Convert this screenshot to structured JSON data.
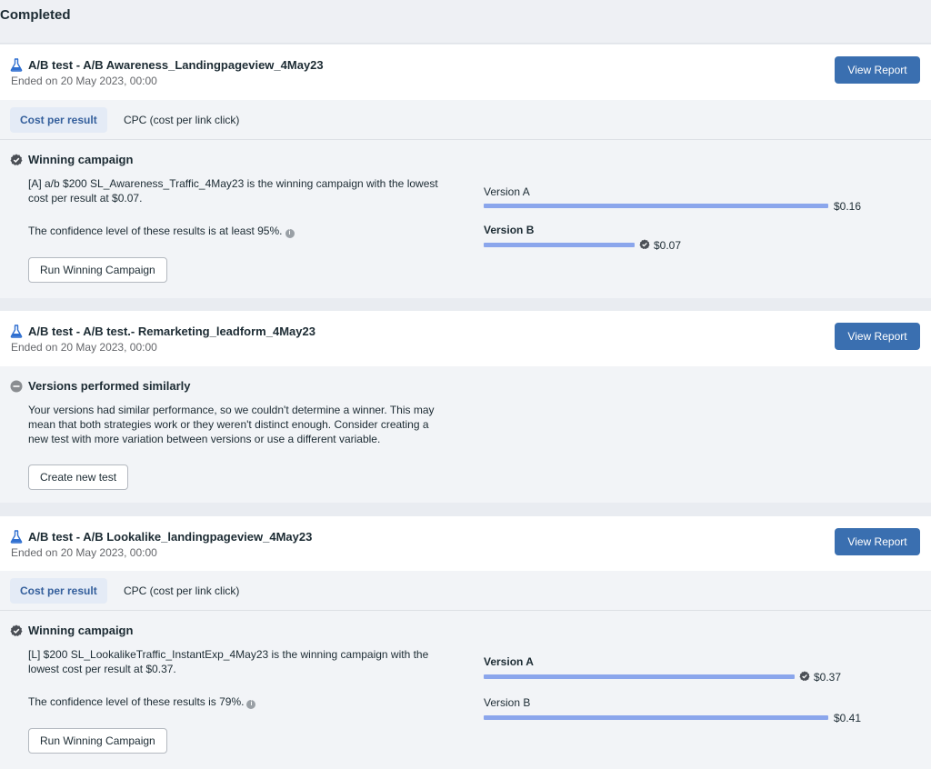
{
  "page": {
    "title": "Completed"
  },
  "tests": [
    {
      "title": "A/B test - A/B Awareness_Landingpageview_4May23",
      "ended": "Ended on 20 May 2023, 00:00",
      "view_report": "View Report",
      "tabs": {
        "active": "Cost per result",
        "other": "CPC (cost per link click)"
      },
      "result": {
        "heading": "Winning campaign",
        "description": "[A] a/b $200 SL_Awareness_Traffic_4May23 is the winning campaign with the lowest cost per result at $0.07.",
        "confidence": "The confidence level of these results is at least 95%.",
        "button": "Run Winning Campaign",
        "versions": [
          {
            "label": "Version A",
            "value": "$0.16",
            "amount": 0.16,
            "winner": false
          },
          {
            "label": "Version B",
            "value": "$0.07",
            "amount": 0.07,
            "winner": true
          }
        ]
      }
    },
    {
      "title": "A/B test - A/B test.- Remarketing_leadform_4May23",
      "ended": "Ended on 20 May 2023, 00:00",
      "view_report": "View Report",
      "result": {
        "heading": "Versions performed similarly",
        "description": "Your versions had similar performance, so we couldn't determine a winner. This may mean that both strategies work or they weren't distinct enough. Consider creating a new test with more variation between versions or use a different variable.",
        "button": "Create new test"
      }
    },
    {
      "title": "A/B test - A/B Lookalike_landingpageview_4May23",
      "ended": "Ended on 20 May 2023, 00:00",
      "view_report": "View Report",
      "tabs": {
        "active": "Cost per result",
        "other": "CPC (cost per link click)"
      },
      "result": {
        "heading": "Winning campaign",
        "description": "[L] $200 SL_LookalikeTraffic_InstantExp_4May23 is the winning campaign with the lowest cost per result at $0.37.",
        "confidence": "The confidence level of these results is 79%.",
        "button": "Run Winning Campaign",
        "versions": [
          {
            "label": "Version A",
            "value": "$0.37",
            "amount": 0.37,
            "winner": true
          },
          {
            "label": "Version B",
            "value": "$0.41",
            "amount": 0.41,
            "winner": false
          }
        ]
      }
    }
  ],
  "colors": {
    "primary_button": "#3a6fb0",
    "bar": "#8ba6ec",
    "active_tab_text": "#345f9c"
  },
  "icons": {
    "test": "flask-icon",
    "winner": "check-circle-icon",
    "similar": "minus-circle-icon",
    "info": "info-icon"
  }
}
